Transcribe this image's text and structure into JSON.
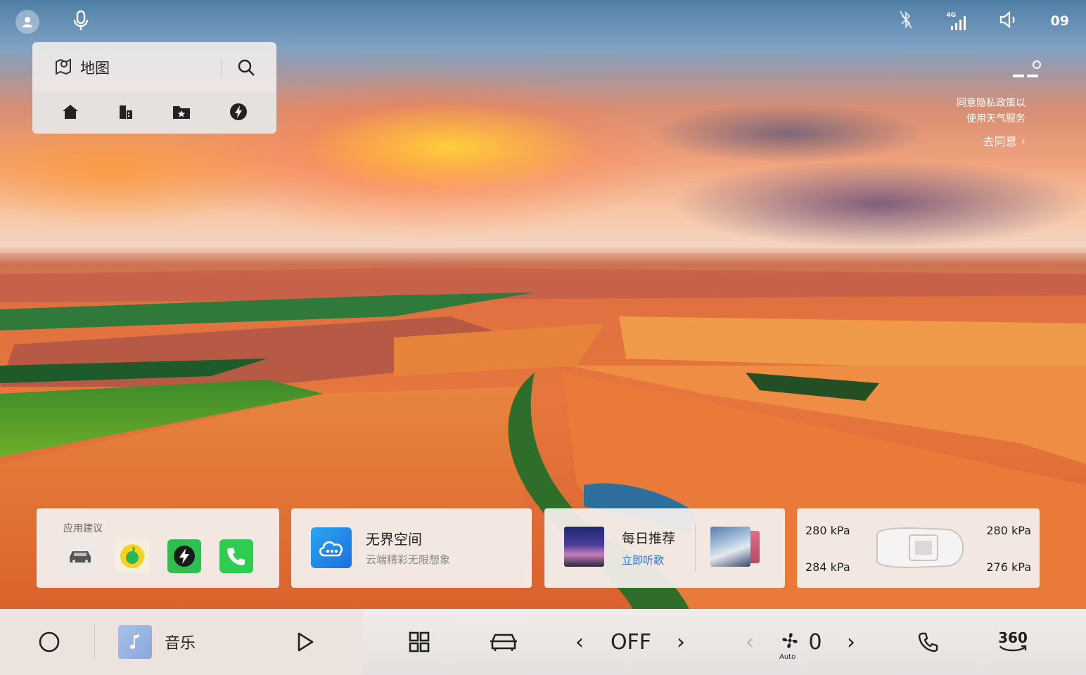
{
  "status_bar": {
    "clock": "09",
    "network_label": "4G",
    "icons": [
      "user-icon",
      "mic-icon",
      "bluetooth-icon",
      "signal-icon",
      "volume-icon"
    ]
  },
  "map_widget": {
    "title": "地图",
    "shortcuts": [
      "home-icon",
      "company-icon",
      "favorites-icon",
      "charging-icon"
    ]
  },
  "weather": {
    "notice_line1": "同意隐私政策以",
    "notice_line2": "使用天气服务",
    "link": "去同意",
    "link_chevron": "›"
  },
  "cards": {
    "apps": {
      "title": "应用建议",
      "items": [
        "car-app-icon",
        "qq-music-icon",
        "charging-app-icon",
        "phone-app-icon"
      ]
    },
    "cloud": {
      "title": "无界空间",
      "subtitle": "云端精彩无限想象"
    },
    "music": {
      "title": "每日推荐",
      "link": "立即听歌"
    },
    "tires": {
      "front_left": "280 kPa",
      "front_right": "280 kPa",
      "rear_left": "284 kPa",
      "rear_right": "276 kPa"
    }
  },
  "dock": {
    "music_label": "音乐",
    "ac_mode": "OFF",
    "fan_level": "0",
    "fan_auto": "Auto",
    "chevron_left": "‹",
    "chevron_right": "›",
    "camera_label": "360"
  },
  "colors": {
    "accent_blue": "#1f6fe0",
    "card_bg": "#f3efec",
    "dock_bg": "#e9e6e4"
  }
}
